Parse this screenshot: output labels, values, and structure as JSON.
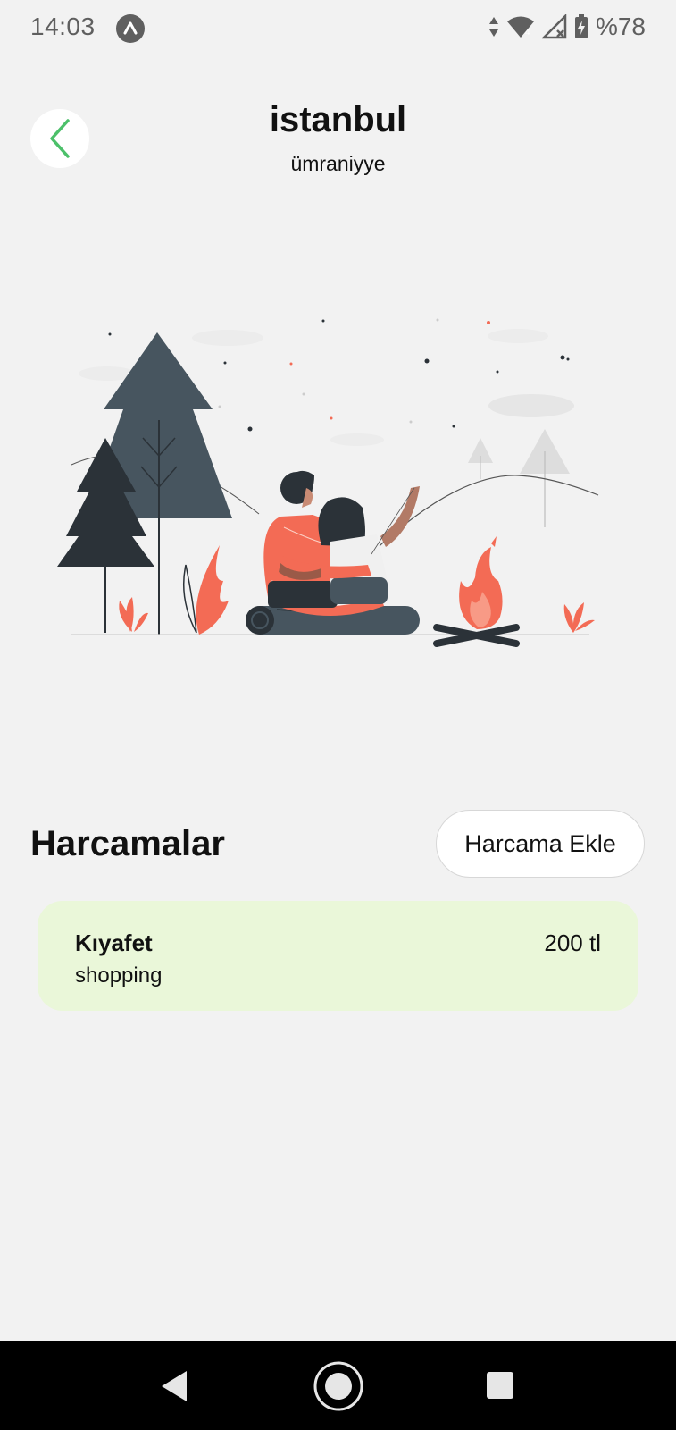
{
  "status_bar": {
    "time": "14:03",
    "battery": "%78",
    "icons": [
      "app-notification-icon",
      "data-arrows-icon",
      "wifi-icon",
      "signal-icon",
      "battery-charging-icon"
    ]
  },
  "header": {
    "back_icon": "chevron-left-icon",
    "title": "istanbul",
    "subtitle": "ümraniyye"
  },
  "expenses": {
    "heading": "Harcamalar",
    "add_button_label": "Harcama Ekle",
    "items": [
      {
        "title": "Kıyafet",
        "category": "shopping",
        "amount": "200 tl"
      }
    ]
  },
  "nav": {
    "icons": [
      "back-triangle-icon",
      "home-circle-icon",
      "recents-square-icon"
    ]
  },
  "colors": {
    "background": "#f2f2f2",
    "accent_green": "#4cc06a",
    "card_background": "#eaf7d9",
    "illustration_orange": "#f36b55",
    "illustration_dark": "#2b3238",
    "illustration_slate": "#47555f",
    "nav_bar": "#000000"
  }
}
